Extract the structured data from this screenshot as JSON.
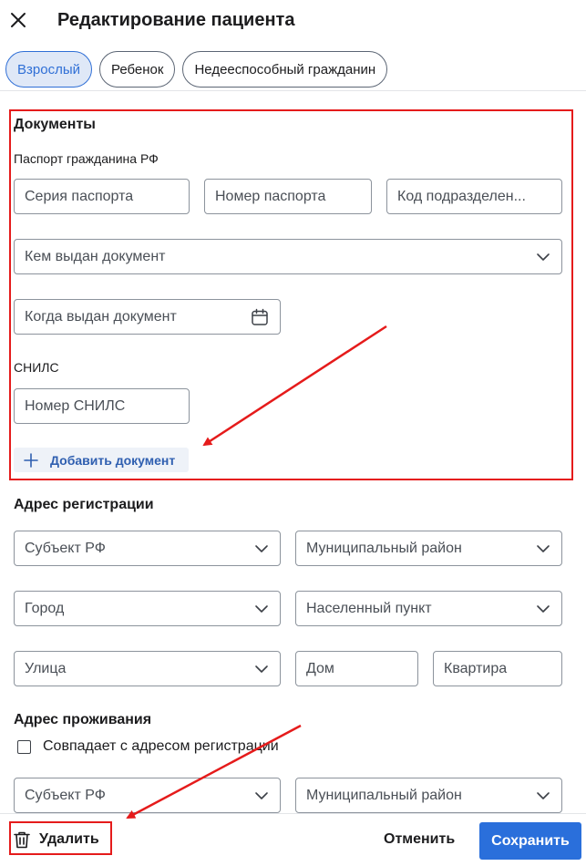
{
  "header": {
    "title": "Редактирование пациента",
    "close_icon": "close-icon"
  },
  "tabs": [
    {
      "label": "Взрослый",
      "active": true
    },
    {
      "label": "Ребенок",
      "active": false
    },
    {
      "label": "Недееспособный гражданин",
      "active": false
    }
  ],
  "documents": {
    "title": "Документы",
    "passport_label": "Паспорт гражданина РФ",
    "passport_series_placeholder": "Серия паспорта",
    "passport_number_placeholder": "Номер паспорта",
    "division_code_placeholder": "Код подразделен...",
    "issued_by_placeholder": "Кем выдан документ",
    "issue_date_placeholder": "Когда выдан документ",
    "snils_label": "СНИЛС",
    "snils_number_placeholder": "Номер СНИЛС",
    "add_document_label": "Добавить документ"
  },
  "registration_address": {
    "title": "Адрес регистрации",
    "subject_placeholder": "Субъект РФ",
    "district_placeholder": "Муниципальный район",
    "city_placeholder": "Город",
    "settlement_placeholder": "Населенный пункт",
    "street_placeholder": "Улица",
    "house_placeholder": "Дом",
    "apartment_placeholder": "Квартира"
  },
  "residence_address": {
    "title": "Адрес проживания",
    "same_as_registration_label": "Совпадает с адресом регистрации",
    "same_as_registration_checked": false,
    "subject_placeholder": "Субъект РФ",
    "district_placeholder": "Муниципальный район"
  },
  "footer": {
    "delete_label": "Удалить",
    "cancel_label": "Отменить",
    "save_label": "Сохранить"
  },
  "colors": {
    "accent": "#2a6fdb",
    "annotation": "#e51b1b"
  }
}
